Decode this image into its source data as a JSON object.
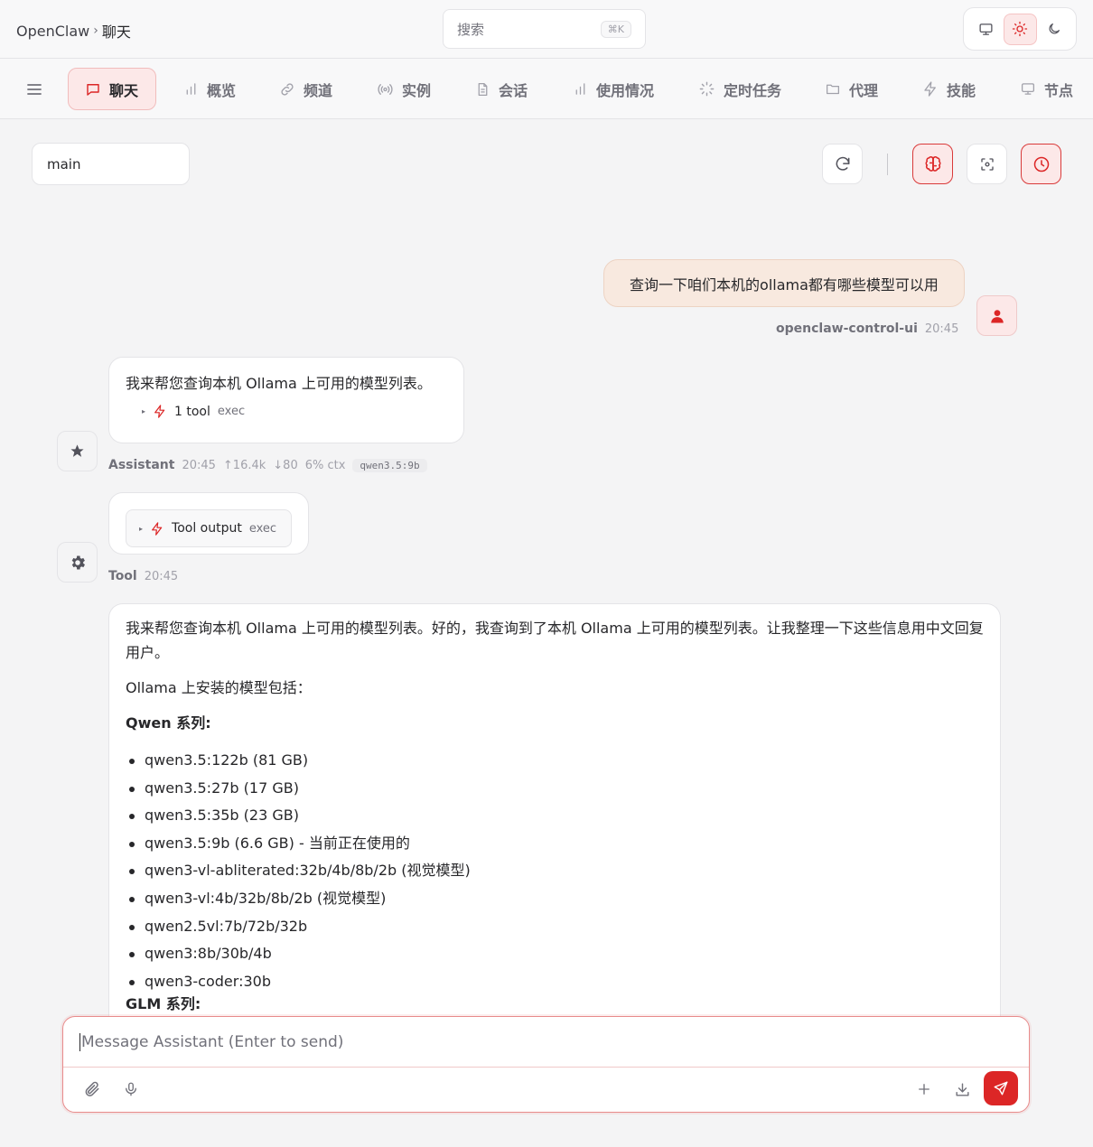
{
  "header": {
    "app_name": "OpenClaw",
    "separator": "›",
    "current_page": "聊天",
    "search": {
      "placeholder": "搜索",
      "shortcut": "⌘K"
    },
    "theme_modes": [
      {
        "name": "system",
        "icon": "monitor-icon",
        "active": false
      },
      {
        "name": "light",
        "icon": "sun-icon",
        "active": true
      },
      {
        "name": "dark",
        "icon": "moon-icon",
        "active": false
      }
    ]
  },
  "nav": {
    "tabs": [
      {
        "label": "聊天",
        "icon": "chat-icon",
        "active": true
      },
      {
        "label": "概览",
        "icon": "bar-chart-icon",
        "active": false
      },
      {
        "label": "频道",
        "icon": "link-icon",
        "active": false
      },
      {
        "label": "实例",
        "icon": "broadcast-icon",
        "active": false
      },
      {
        "label": "会话",
        "icon": "document-icon",
        "active": false
      },
      {
        "label": "使用情况",
        "icon": "bar-chart-icon",
        "active": false
      },
      {
        "label": "定时任务",
        "icon": "loader-icon",
        "active": false
      },
      {
        "label": "代理",
        "icon": "folder-icon",
        "active": false
      },
      {
        "label": "技能",
        "icon": "lightning-icon",
        "active": false
      },
      {
        "label": "节点",
        "icon": "monitor-icon",
        "active": false
      }
    ]
  },
  "chat_toolbar": {
    "session": "main",
    "buttons": [
      {
        "name": "refresh",
        "icon": "refresh-icon",
        "active": false
      },
      {
        "name": "thinking",
        "icon": "brain-icon",
        "active": true
      },
      {
        "name": "focus",
        "icon": "focus-icon",
        "active": false
      },
      {
        "name": "history",
        "icon": "clock-icon",
        "active": true
      }
    ]
  },
  "messages": {
    "user": {
      "text": "查询一下咱们本机的ollama都有哪些模型可以用",
      "sender": "openclaw-control-ui",
      "time": "20:45"
    },
    "assistant": {
      "text": "我来帮您查询本机 Ollama 上可用的模型列表。",
      "tool_count": "1 tool",
      "tool_kind": "exec",
      "sender": "Assistant",
      "time": "20:45",
      "tokens_up": "↑16.4k",
      "tokens_down": "↓80",
      "ctx": "6% ctx",
      "model": "qwen3.5:9b"
    },
    "tool": {
      "label": "Tool output",
      "kind": "exec",
      "sender": "Tool",
      "time": "20:45"
    },
    "answer": {
      "intro": "我来帮您查询本机 Ollama 上可用的模型列表。好的，我查询到了本机 Ollama 上可用的模型列表。让我整理一下这些信息用中文回复用户。",
      "lead": "Ollama 上安装的模型包括：",
      "qwen_heading": "Qwen 系列:",
      "qwen_models": [
        "qwen3.5:122b (81 GB)",
        "qwen3.5:27b (17 GB)",
        "qwen3.5:35b (23 GB)",
        "qwen3.5:9b (6.6 GB) - 当前正在使用的",
        "qwen3-vl-abliterated:32b/4b/8b/2b (视觉模型)",
        "qwen3-vl:4b/32b/8b/2b (视觉模型)",
        "qwen2.5vl:7b/72b/32b",
        "qwen3:8b/30b/4b",
        "qwen3-coder:30b"
      ],
      "glm_heading": "GLM 系列:"
    }
  },
  "composer": {
    "placeholder": "Message Assistant (Enter to send)"
  },
  "colors": {
    "accent": "#dc2626",
    "accent_soft": "#fce8e8",
    "user_bubble": "#f8e9df"
  }
}
